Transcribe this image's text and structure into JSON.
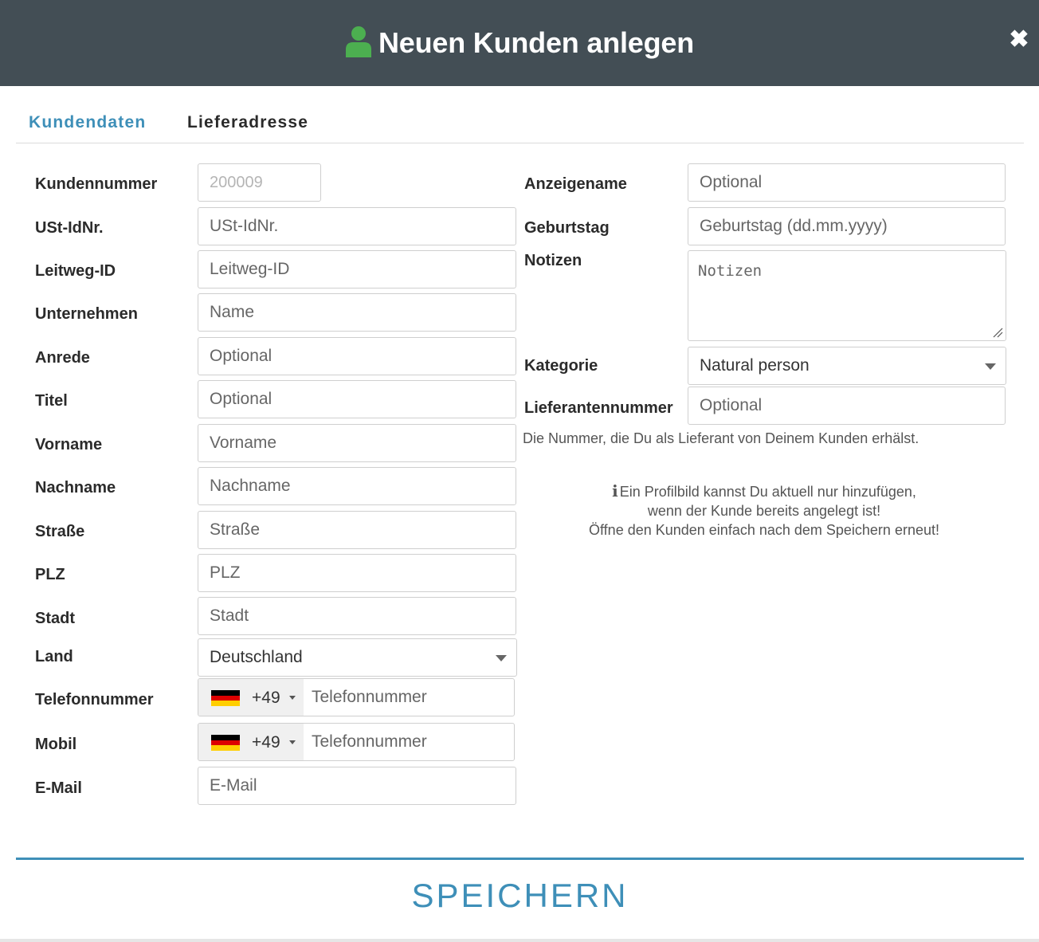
{
  "modal": {
    "title": "Neuen Kunden anlegen",
    "close_label": "✖"
  },
  "tabs": [
    {
      "label": "Kundendaten",
      "active": true
    },
    {
      "label": "Lieferadresse",
      "active": false
    }
  ],
  "left_fields": {
    "kundennummer": {
      "label": "Kundennummer",
      "value": "200009"
    },
    "ustid": {
      "label": "USt-IdNr.",
      "placeholder": "USt-IdNr."
    },
    "leitweg": {
      "label": "Leitweg-ID",
      "placeholder": "Leitweg-ID"
    },
    "unternehmen": {
      "label": "Unternehmen",
      "placeholder": "Name"
    },
    "anrede": {
      "label": "Anrede",
      "placeholder": "Optional"
    },
    "titel": {
      "label": "Titel",
      "placeholder": "Optional"
    },
    "vorname": {
      "label": "Vorname",
      "placeholder": "Vorname"
    },
    "nachname": {
      "label": "Nachname",
      "placeholder": "Nachname"
    },
    "strasse": {
      "label": "Straße",
      "placeholder": "Straße"
    },
    "plz": {
      "label": "PLZ",
      "placeholder": "PLZ"
    },
    "stadt": {
      "label": "Stadt",
      "placeholder": "Stadt"
    },
    "land": {
      "label": "Land",
      "value": "Deutschland"
    },
    "telefon": {
      "label": "Telefonnummer",
      "country_code": "+49",
      "placeholder": "Telefonnummer"
    },
    "mobil": {
      "label": "Mobil",
      "country_code": "+49",
      "placeholder": "Telefonnummer"
    },
    "email": {
      "label": "E-Mail",
      "placeholder": "E-Mail"
    }
  },
  "right_fields": {
    "anzeigename": {
      "label": "Anzeigename",
      "placeholder": "Optional"
    },
    "geburtstag": {
      "label": "Geburtstag",
      "placeholder": "Geburtstag (dd.mm.yyyy)"
    },
    "notizen": {
      "label": "Notizen",
      "placeholder": "Notizen"
    },
    "kategorie": {
      "label": "Kategorie",
      "value": "Natural person"
    },
    "lieferantennummer": {
      "label": "Lieferantennummer",
      "placeholder": "Optional",
      "hint": "Die Nummer, die Du als Lieferant von Deinem Kunden erhälst."
    }
  },
  "info": {
    "line1": "Ein Profilbild kannst Du aktuell nur hinzufügen,",
    "line2": "wenn der Kunde bereits angelegt ist!",
    "line3": "Öffne den Kunden einfach nach dem Speichern erneut!"
  },
  "footer": {
    "save_label": "SPEICHERN"
  },
  "colors": {
    "header_bg": "#434e55",
    "accent": "#3e8fb8",
    "user_icon": "#4caf50"
  }
}
